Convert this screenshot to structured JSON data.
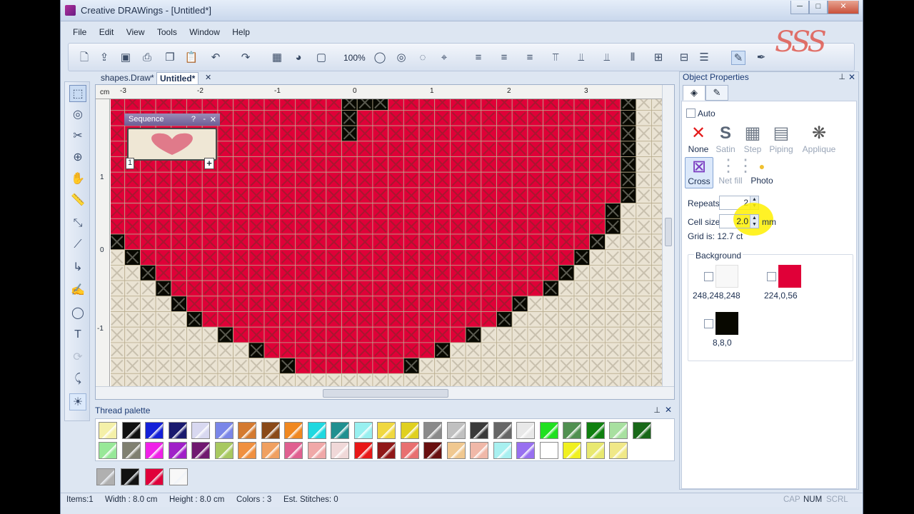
{
  "window": {
    "title": "Creative DRAWings - [Untitled*]",
    "minimize": "─",
    "maximize": "□",
    "close": "✕"
  },
  "menu": [
    "File",
    "Edit",
    "View",
    "Tools",
    "Window",
    "Help"
  ],
  "toolbar": {
    "zoom": "100%"
  },
  "logo": "SSS",
  "tabs": [
    {
      "label": "shapes.Draw*"
    },
    {
      "label": "Untitled*",
      "close": "✕"
    }
  ],
  "ruler": {
    "unit": "cm",
    "h_ticks": [
      "-3",
      "-2",
      "-1",
      "0",
      "1",
      "2",
      "3"
    ],
    "v_ticks": [
      "1",
      "0",
      "-1"
    ]
  },
  "sequence": {
    "title": "Sequence",
    "index": "1",
    "add": "+",
    "pin": "⌗",
    "help": "?",
    "min": "-",
    "close": "✕"
  },
  "palette": {
    "title": "Thread palette",
    "row1": [
      "#f4f0a8",
      "#111111",
      "#1420d8",
      "#1a1a6e",
      "#d8d8f0",
      "#7a86e8",
      "#d47a30",
      "#8a4a18",
      "#f08820",
      "#20d8e0",
      "#209090",
      "#98f0f0",
      "#f0d840",
      "#e0d020",
      "#8a8a8a",
      "#c0c0c0",
      "#3a3a3a",
      "#666666",
      "#e8e8e8",
      "#20e020",
      "#509050",
      "#108010",
      "#a8e0a0",
      "#186818"
    ],
    "row2": [
      "#98e898",
      "#808070",
      "#f020e8",
      "#a020c8",
      "#701870",
      "#a8c860",
      "#f09040",
      "#f0a060",
      "#e06090",
      "#f0a8a8",
      "#f0d8d8",
      "#e81818",
      "#901818",
      "#e87070",
      "#680f0f",
      "#f0c890",
      "#f0b8a8",
      "#a8f0f0",
      "#9870f0",
      "#ffffff",
      "#f0f020",
      "#e8e870",
      "#f0e888"
    ],
    "recent": [
      "#b0b0b0",
      "#111111",
      "#e0003a",
      "#f8f8f8"
    ]
  },
  "props": {
    "title": "Object Properties",
    "auto": "Auto",
    "fills": [
      {
        "label": "None",
        "icon": "✕",
        "enabled": true
      },
      {
        "label": "Satin",
        "icon": "S",
        "enabled": false
      },
      {
        "label": "Step",
        "icon": "▦",
        "enabled": false
      },
      {
        "label": "Piping",
        "icon": "▤",
        "enabled": false
      },
      {
        "label": "Applique",
        "icon": "❋",
        "enabled": false
      }
    ],
    "fills2": [
      {
        "label": "Cross",
        "icon": "⊠",
        "enabled": true,
        "selected": true
      },
      {
        "label": "Net fill",
        "icon": "⋮⋮",
        "enabled": false
      },
      {
        "label": "Photo",
        "icon": "●",
        "enabled": true
      }
    ],
    "repeats_label": "Repeats",
    "repeats_value": "2",
    "cellsize_label": "Cell size",
    "cellsize_value": "2.0",
    "cellsize_unit": "mm",
    "grid_label": "Grid is: 12.7 ct",
    "background_label": "Background",
    "colors": [
      {
        "rgb": "248,248,248",
        "hex": "#f8f8f8"
      },
      {
        "rgb": "224,0,56",
        "hex": "#e00038"
      },
      {
        "rgb": "8,8,0",
        "hex": "#080800"
      }
    ]
  },
  "status": {
    "items": "Items:1",
    "width": "Width : 8.0 cm",
    "height": "Height : 8.0 cm",
    "colors": "Colors : 3",
    "stitches": "Est. Stitches: 0",
    "cap": "CAP",
    "num": "NUM",
    "scrl": "SCRL"
  }
}
